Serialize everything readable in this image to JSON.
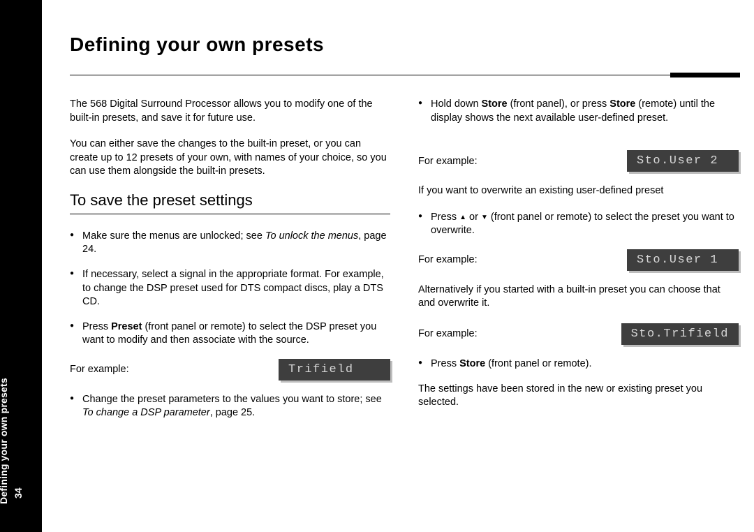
{
  "sidebar": {
    "section": "Defining your own presets",
    "page": "34"
  },
  "heading": "Defining your own presets",
  "intro1": "The 568 Digital Surround Processor allows you to modify one of the built-in presets, and save it for future use.",
  "intro2": "You can either save the changes to the built-in preset, or you can create up to 12 presets of your own, with names of your choice, so you can use them alongside the built-in presets.",
  "subheading": "To save the preset settings",
  "steps": {
    "s1a": "Make sure the menus are unlocked; see ",
    "s1i": "To unlock the menus",
    "s1b": ", page 24.",
    "s2": "If necessary, select a signal in the appropriate format. For example, to change the DSP preset used for DTS compact discs, play a DTS CD.",
    "s3a": "Press ",
    "s3b": "Preset",
    "s3c": " (front panel or remote) to select the DSP preset you want to modify and then associate with the source.",
    "s4a": "Change the preset parameters to the values you want to store; see ",
    "s4i": "To change a DSP parameter",
    "s4b": ", page 25."
  },
  "forExample": "For example:",
  "lcd": {
    "trifield": "Trifield",
    "user2": "Sto.User 2",
    "user1": "Sto.User 1",
    "stoTrifield": "Sto.Trifield"
  },
  "right": {
    "r1a": "Hold down ",
    "r1b": "Store",
    "r1c": " (front panel), or press ",
    "r1d": "Store",
    "r1e": " (remote) until the display shows the next available user-defined preset.",
    "r2": "If you want to overwrite an existing user-defined preset",
    "r3a": "Press ",
    "r3b": " or ",
    "r3c": " (front panel or remote) to select the preset you want to overwrite.",
    "r4": "Alternatively if you started with a built-in preset you can choose that and overwrite it.",
    "r5a": "Press ",
    "r5b": "Store",
    "r5c": " (front panel or remote).",
    "r6": "The settings have been stored in the new or existing preset you selected."
  }
}
